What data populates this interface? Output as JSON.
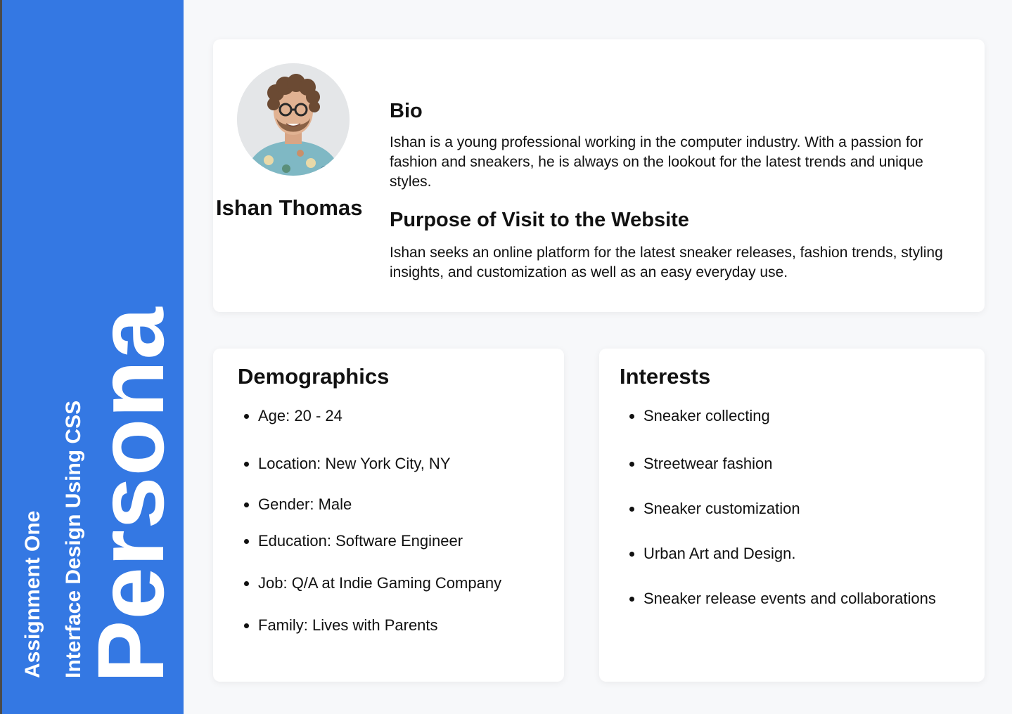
{
  "sidebar": {
    "line1": "Assignment One",
    "line2": "Interface Design Using CSS",
    "big_title": "Persona"
  },
  "profile": {
    "name": "Ishan Thomas",
    "bio_title": "Bio",
    "bio_text": "Ishan is a young professional working in the computer industry. With a passion for fashion and sneakers, he is always on the lookout for the latest trends and unique styles.",
    "purpose_title": "Purpose of Visit to the Website",
    "purpose_text": "Ishan seeks an online platform for the latest sneaker releases, fashion trends, styling insights, and customization as well as an easy everyday use."
  },
  "demographics": {
    "title": "Demographics",
    "items": [
      "Age: 20 - 24",
      "Location: New York City, NY",
      "Gender: Male",
      "Education: Software Engineer",
      "Job: Q/A at Indie Gaming Company",
      "Family: Lives with Parents"
    ]
  },
  "interests": {
    "title": "Interests",
    "items": [
      "Sneaker collecting",
      "Streetwear fashion",
      "Sneaker customization",
      "Urban Art and Design.",
      "Sneaker release events and collaborations"
    ]
  },
  "colors": {
    "sidebar": "#3478e3",
    "background": "#f7f8fa",
    "card": "#ffffff",
    "text": "#111111"
  }
}
